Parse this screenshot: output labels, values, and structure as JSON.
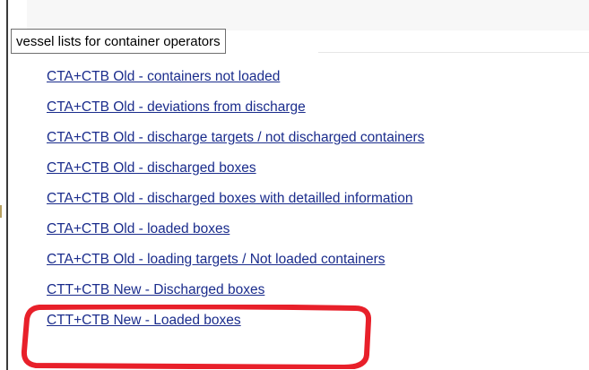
{
  "section": {
    "title": "vessel lists for container operators"
  },
  "reports": [
    {
      "label": "CTA+CTB Old - containers not loaded"
    },
    {
      "label": "CTA+CTB Old - deviations from discharge"
    },
    {
      "label": "CTA+CTB Old - discharge targets / not discharged containers"
    },
    {
      "label": "CTA+CTB Old - discharged boxes"
    },
    {
      "label": "CTA+CTB Old - discharged boxes with detailled information"
    },
    {
      "label": "CTA+CTB Old - loaded boxes"
    },
    {
      "label": "CTA+CTB Old - loading targets / Not loaded containers"
    },
    {
      "label": "CTT+CTB New - Discharged boxes"
    },
    {
      "label": "CTT+CTB New - Loaded boxes"
    }
  ],
  "colors": {
    "link": "#1a2c8c",
    "annotation": "#e8202a"
  }
}
